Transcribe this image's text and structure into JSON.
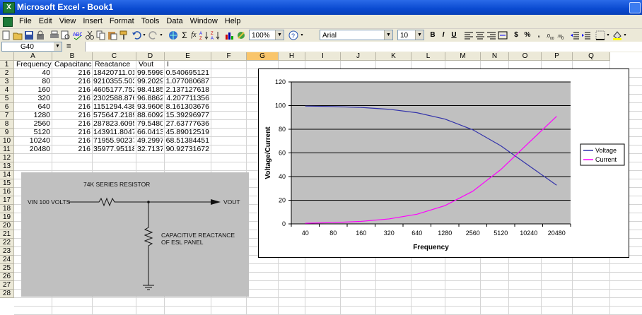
{
  "window": {
    "title": "Microsoft Excel - Book1"
  },
  "menu": [
    "File",
    "Edit",
    "View",
    "Insert",
    "Format",
    "Tools",
    "Data",
    "Window",
    "Help"
  ],
  "toolbar": {
    "zoom": "100%",
    "font": "Arial",
    "font_size": "10",
    "bold": "B",
    "italic": "I",
    "underline": "U",
    "currency": "$",
    "percent": "%",
    "comma": ","
  },
  "formula_bar": {
    "name_box": "G40",
    "equals": "=",
    "formula": ""
  },
  "columns": [
    "A",
    "B",
    "C",
    "D",
    "E",
    "F",
    "G",
    "H",
    "I",
    "J",
    "K",
    "L",
    "M",
    "N",
    "O",
    "P",
    "Q"
  ],
  "selected_column": "G",
  "rows": [
    "1",
    "2",
    "3",
    "4",
    "5",
    "6",
    "7",
    "8",
    "9",
    "10",
    "11",
    "12",
    "13",
    "14",
    "15",
    "16",
    "17",
    "18",
    "19",
    "20",
    "21",
    "22",
    "23",
    "24",
    "25",
    "26",
    "27",
    "28"
  ],
  "table": {
    "headers": [
      "Frequency",
      "Capacitance",
      "Reactance",
      "Vout",
      "I"
    ],
    "data": [
      [
        "40",
        "216",
        "18420711.01",
        "99.59989",
        "0.540695121"
      ],
      [
        "80",
        "216",
        "9210355.503",
        "99.20296",
        "1.077080687"
      ],
      [
        "160",
        "216",
        "4605177.752",
        "98.41853",
        "2.137127618"
      ],
      [
        "320",
        "216",
        "2302588.876",
        "96.88629",
        "4.207711356"
      ],
      [
        "640",
        "216",
        "1151294.438",
        "93.96064",
        "8.161303676"
      ],
      [
        "1280",
        "216",
        "575647.2189",
        "88.6092",
        "15.39296977"
      ],
      [
        "2560",
        "216",
        "287823.6095",
        "79.54805",
        "27.63777636"
      ],
      [
        "5120",
        "216",
        "143911.8047",
        "66.04131",
        "45.89012519"
      ],
      [
        "10240",
        "216",
        "71955.90237",
        "49.29976",
        "68.51384451"
      ],
      [
        "20480",
        "216",
        "35977.95118",
        "32.71379",
        "90.92731672"
      ]
    ]
  },
  "circuit": {
    "title": "74K SERIES RESISTOR",
    "vin": "VIN 100 VOLTS",
    "vout": "VOUT",
    "cap_label_1": "CAPACITIVE REACTANCE",
    "cap_label_2": "OF ESL PANEL"
  },
  "chart_data": {
    "type": "line",
    "categories": [
      "40",
      "80",
      "160",
      "320",
      "640",
      "1280",
      "2560",
      "5120",
      "10240",
      "20480"
    ],
    "series": [
      {
        "name": "Voltage",
        "color": "#3333aa",
        "values": [
          99.59989,
          99.20296,
          98.41853,
          96.88629,
          93.96064,
          88.6092,
          79.54805,
          66.04131,
          49.29976,
          32.71379
        ]
      },
      {
        "name": "Current",
        "color": "#ff00ff",
        "values": [
          0.540695121,
          1.077080687,
          2.137127618,
          4.207711356,
          8.161303676,
          15.39296977,
          27.63777636,
          45.89012519,
          68.51384451,
          90.92731672
        ]
      }
    ],
    "xlabel": "Frequency",
    "ylabel": "Voltage/Current",
    "ylim": [
      0,
      120
    ],
    "yticks": [
      "0",
      "20",
      "40",
      "60",
      "80",
      "100",
      "120"
    ],
    "grid": true,
    "legend": "right"
  }
}
